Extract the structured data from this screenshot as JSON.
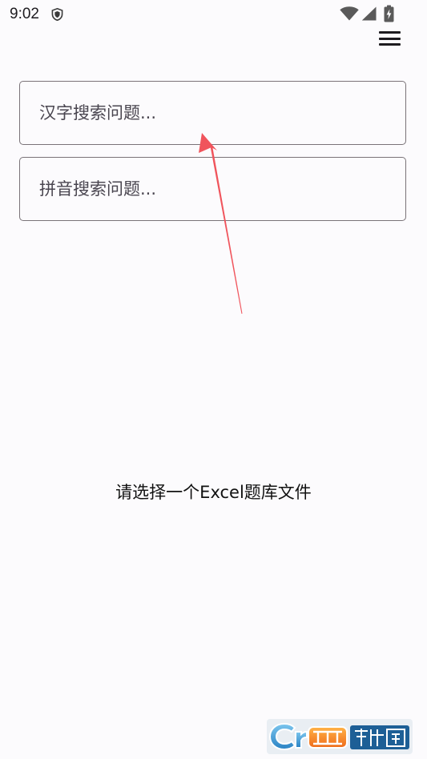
{
  "status_bar": {
    "time": "9:02",
    "icons": [
      "shield-icon",
      "wifi-icon",
      "cell-signal-icon",
      "battery-charging-icon"
    ]
  },
  "toolbar": {
    "menu_icon": "hamburger-menu-icon"
  },
  "search": {
    "hanzi_placeholder": "汉字搜索问题...",
    "pinyin_placeholder": "拼音搜索问题..."
  },
  "main": {
    "empty_message": "请选择一个Excel题库文件"
  },
  "annotation": {
    "arrow_color": "#f0545c"
  },
  "watermark": {
    "logo": "cr173-logo"
  },
  "colors": {
    "background": "#fcfbfd",
    "field_border": "#7a7378",
    "text_primary": "#111111",
    "placeholder": "#49454f"
  }
}
